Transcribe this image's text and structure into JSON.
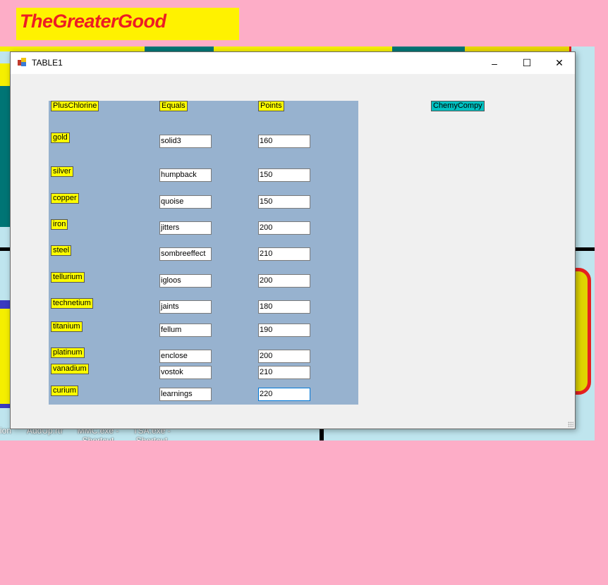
{
  "banner": {
    "text": "TheGreaterGood"
  },
  "desktop": {
    "icons": [
      "ion",
      "AddUp.rtf",
      "MMC.exe - Shortcut",
      "TSA.exe - Shortcut"
    ]
  },
  "window": {
    "title": "TABLE1",
    "minimize": "–",
    "maximize": "☐",
    "close": "✕"
  },
  "table": {
    "headers": {
      "element": "PlusChlorine",
      "equals": "Equals",
      "points": "Points"
    },
    "rows": [
      {
        "element": "gold",
        "equals": "solid3",
        "points": "160"
      },
      {
        "element": "silver",
        "equals": "humpback",
        "points": "150"
      },
      {
        "element": "copper",
        "equals": "quoise",
        "points": "150"
      },
      {
        "element": "iron",
        "equals": "jitters",
        "points": "200"
      },
      {
        "element": "steel",
        "equals": "sombreeffect",
        "points": "210"
      },
      {
        "element": "tellurium",
        "equals": "igloos",
        "points": "200"
      },
      {
        "element": "technetium",
        "equals": "jaints",
        "points": "180"
      },
      {
        "element": "titanium",
        "equals": "fellum",
        "points": "190"
      },
      {
        "element": "platinum",
        "equals": "enclose",
        "points": "200"
      },
      {
        "element": "vanadium",
        "equals": "vostok",
        "points": "210"
      },
      {
        "element": "curium",
        "equals": "learnings",
        "points": "220"
      }
    ]
  },
  "chemy_label": "ChemyCompy",
  "colors": {
    "background": "#fdadc7",
    "banner": "#fff200",
    "banner_text": "#ed1c24",
    "panel": "#97b2cf",
    "label": "#ffff00",
    "chemy": "#00c0c0"
  }
}
